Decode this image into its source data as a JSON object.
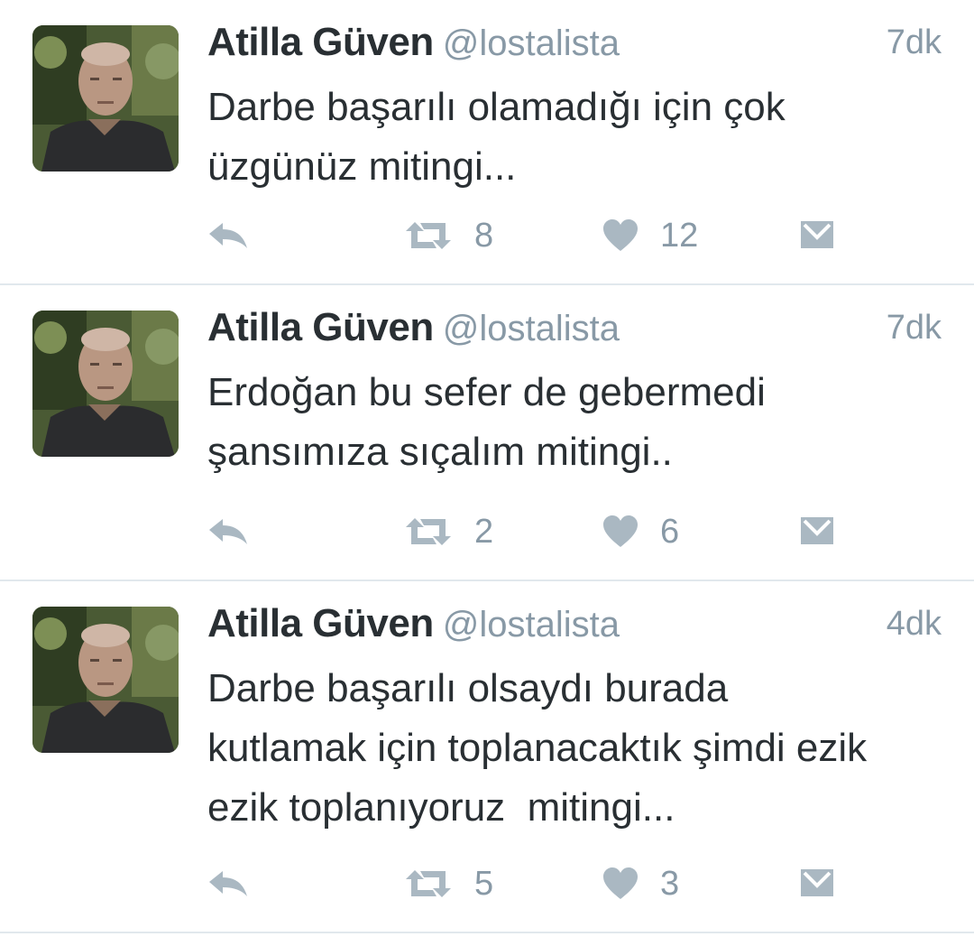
{
  "colors": {
    "text": "#292f33",
    "secondary": "#8899a6",
    "divider": "#e1e8ed",
    "icon": "#aab8c2"
  },
  "icons": {
    "reply": "reply-icon",
    "retweet": "retweet-icon",
    "like": "heart-icon",
    "message": "direct-message-icon"
  },
  "tweets": [
    {
      "name": "Atilla Güven",
      "handle": "@lostalista",
      "time": "7dk",
      "text": "Darbe başarılı olamadığı için çok\nüzgünüz mitingi...",
      "retweets": "8",
      "likes": "12"
    },
    {
      "name": "Atilla Güven",
      "handle": "@lostalista",
      "time": "7dk",
      "text": "Erdoğan bu sefer de gebermedi\nşansımıza sıçalım mitingi..",
      "retweets": "2",
      "likes": "6"
    },
    {
      "name": "Atilla Güven",
      "handle": "@lostalista",
      "time": "4dk",
      "text": "Darbe başarılı olsaydı burada\nkutlamak için toplanacaktık şimdi ezik\nezik toplanıyoruz  mitingi...",
      "retweets": "5",
      "likes": "3"
    }
  ]
}
